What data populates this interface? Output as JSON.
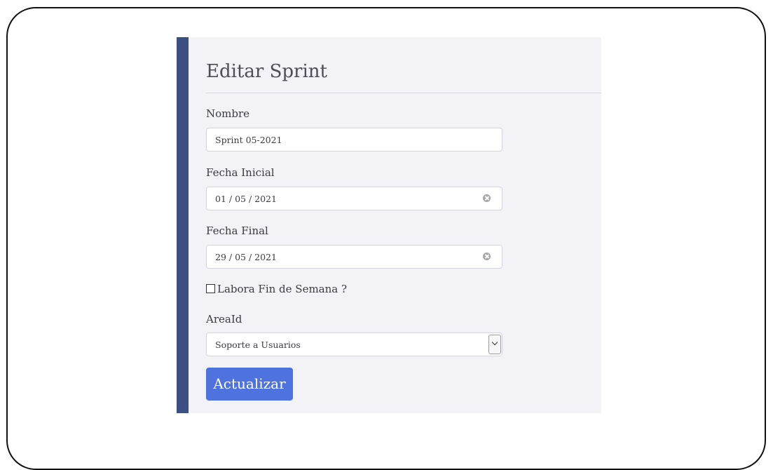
{
  "form": {
    "title": "Editar Sprint",
    "nombre": {
      "label": "Nombre",
      "value": "Sprint 05-2021"
    },
    "fecha_inicial": {
      "label": "Fecha Inicial",
      "value": "01 / 05 / 2021"
    },
    "fecha_final": {
      "label": "Fecha Final",
      "value": "29 / 05 / 2021"
    },
    "fin_de_semana": {
      "label": "Labora Fin de Semana ?",
      "checked": false
    },
    "area": {
      "label": "AreaId",
      "selected": "Soporte a Usuarios"
    },
    "submit_label": "Actualizar"
  },
  "colors": {
    "accent_bar": "#3c4f82",
    "panel_bg": "#f2f2f7",
    "button_bg": "#4e73df"
  },
  "icons": {
    "date_clear": "clear-icon",
    "select_toggle": "chevron-down-icon"
  }
}
